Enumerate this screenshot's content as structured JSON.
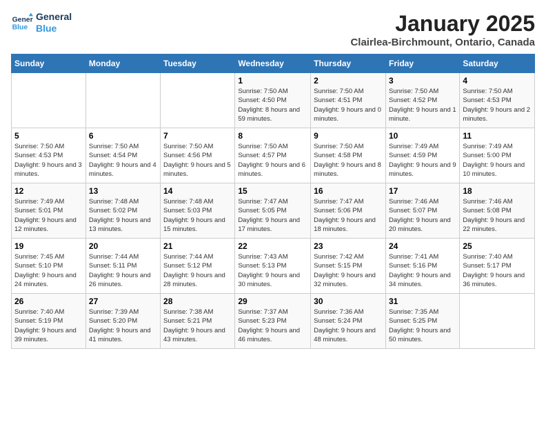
{
  "header": {
    "logo_line1": "General",
    "logo_line2": "Blue",
    "title": "January 2025",
    "subtitle": "Clairlea-Birchmount, Ontario, Canada"
  },
  "weekdays": [
    "Sunday",
    "Monday",
    "Tuesday",
    "Wednesday",
    "Thursday",
    "Friday",
    "Saturday"
  ],
  "weeks": [
    [
      {
        "day": "",
        "sunrise": "",
        "sunset": "",
        "daylight": ""
      },
      {
        "day": "",
        "sunrise": "",
        "sunset": "",
        "daylight": ""
      },
      {
        "day": "",
        "sunrise": "",
        "sunset": "",
        "daylight": ""
      },
      {
        "day": "1",
        "sunrise": "Sunrise: 7:50 AM",
        "sunset": "Sunset: 4:50 PM",
        "daylight": "Daylight: 8 hours and 59 minutes."
      },
      {
        "day": "2",
        "sunrise": "Sunrise: 7:50 AM",
        "sunset": "Sunset: 4:51 PM",
        "daylight": "Daylight: 9 hours and 0 minutes."
      },
      {
        "day": "3",
        "sunrise": "Sunrise: 7:50 AM",
        "sunset": "Sunset: 4:52 PM",
        "daylight": "Daylight: 9 hours and 1 minute."
      },
      {
        "day": "4",
        "sunrise": "Sunrise: 7:50 AM",
        "sunset": "Sunset: 4:53 PM",
        "daylight": "Daylight: 9 hours and 2 minutes."
      }
    ],
    [
      {
        "day": "5",
        "sunrise": "Sunrise: 7:50 AM",
        "sunset": "Sunset: 4:53 PM",
        "daylight": "Daylight: 9 hours and 3 minutes."
      },
      {
        "day": "6",
        "sunrise": "Sunrise: 7:50 AM",
        "sunset": "Sunset: 4:54 PM",
        "daylight": "Daylight: 9 hours and 4 minutes."
      },
      {
        "day": "7",
        "sunrise": "Sunrise: 7:50 AM",
        "sunset": "Sunset: 4:56 PM",
        "daylight": "Daylight: 9 hours and 5 minutes."
      },
      {
        "day": "8",
        "sunrise": "Sunrise: 7:50 AM",
        "sunset": "Sunset: 4:57 PM",
        "daylight": "Daylight: 9 hours and 6 minutes."
      },
      {
        "day": "9",
        "sunrise": "Sunrise: 7:50 AM",
        "sunset": "Sunset: 4:58 PM",
        "daylight": "Daylight: 9 hours and 8 minutes."
      },
      {
        "day": "10",
        "sunrise": "Sunrise: 7:49 AM",
        "sunset": "Sunset: 4:59 PM",
        "daylight": "Daylight: 9 hours and 9 minutes."
      },
      {
        "day": "11",
        "sunrise": "Sunrise: 7:49 AM",
        "sunset": "Sunset: 5:00 PM",
        "daylight": "Daylight: 9 hours and 10 minutes."
      }
    ],
    [
      {
        "day": "12",
        "sunrise": "Sunrise: 7:49 AM",
        "sunset": "Sunset: 5:01 PM",
        "daylight": "Daylight: 9 hours and 12 minutes."
      },
      {
        "day": "13",
        "sunrise": "Sunrise: 7:48 AM",
        "sunset": "Sunset: 5:02 PM",
        "daylight": "Daylight: 9 hours and 13 minutes."
      },
      {
        "day": "14",
        "sunrise": "Sunrise: 7:48 AM",
        "sunset": "Sunset: 5:03 PM",
        "daylight": "Daylight: 9 hours and 15 minutes."
      },
      {
        "day": "15",
        "sunrise": "Sunrise: 7:47 AM",
        "sunset": "Sunset: 5:05 PM",
        "daylight": "Daylight: 9 hours and 17 minutes."
      },
      {
        "day": "16",
        "sunrise": "Sunrise: 7:47 AM",
        "sunset": "Sunset: 5:06 PM",
        "daylight": "Daylight: 9 hours and 18 minutes."
      },
      {
        "day": "17",
        "sunrise": "Sunrise: 7:46 AM",
        "sunset": "Sunset: 5:07 PM",
        "daylight": "Daylight: 9 hours and 20 minutes."
      },
      {
        "day": "18",
        "sunrise": "Sunrise: 7:46 AM",
        "sunset": "Sunset: 5:08 PM",
        "daylight": "Daylight: 9 hours and 22 minutes."
      }
    ],
    [
      {
        "day": "19",
        "sunrise": "Sunrise: 7:45 AM",
        "sunset": "Sunset: 5:10 PM",
        "daylight": "Daylight: 9 hours and 24 minutes."
      },
      {
        "day": "20",
        "sunrise": "Sunrise: 7:44 AM",
        "sunset": "Sunset: 5:11 PM",
        "daylight": "Daylight: 9 hours and 26 minutes."
      },
      {
        "day": "21",
        "sunrise": "Sunrise: 7:44 AM",
        "sunset": "Sunset: 5:12 PM",
        "daylight": "Daylight: 9 hours and 28 minutes."
      },
      {
        "day": "22",
        "sunrise": "Sunrise: 7:43 AM",
        "sunset": "Sunset: 5:13 PM",
        "daylight": "Daylight: 9 hours and 30 minutes."
      },
      {
        "day": "23",
        "sunrise": "Sunrise: 7:42 AM",
        "sunset": "Sunset: 5:15 PM",
        "daylight": "Daylight: 9 hours and 32 minutes."
      },
      {
        "day": "24",
        "sunrise": "Sunrise: 7:41 AM",
        "sunset": "Sunset: 5:16 PM",
        "daylight": "Daylight: 9 hours and 34 minutes."
      },
      {
        "day": "25",
        "sunrise": "Sunrise: 7:40 AM",
        "sunset": "Sunset: 5:17 PM",
        "daylight": "Daylight: 9 hours and 36 minutes."
      }
    ],
    [
      {
        "day": "26",
        "sunrise": "Sunrise: 7:40 AM",
        "sunset": "Sunset: 5:19 PM",
        "daylight": "Daylight: 9 hours and 39 minutes."
      },
      {
        "day": "27",
        "sunrise": "Sunrise: 7:39 AM",
        "sunset": "Sunset: 5:20 PM",
        "daylight": "Daylight: 9 hours and 41 minutes."
      },
      {
        "day": "28",
        "sunrise": "Sunrise: 7:38 AM",
        "sunset": "Sunset: 5:21 PM",
        "daylight": "Daylight: 9 hours and 43 minutes."
      },
      {
        "day": "29",
        "sunrise": "Sunrise: 7:37 AM",
        "sunset": "Sunset: 5:23 PM",
        "daylight": "Daylight: 9 hours and 46 minutes."
      },
      {
        "day": "30",
        "sunrise": "Sunrise: 7:36 AM",
        "sunset": "Sunset: 5:24 PM",
        "daylight": "Daylight: 9 hours and 48 minutes."
      },
      {
        "day": "31",
        "sunrise": "Sunrise: 7:35 AM",
        "sunset": "Sunset: 5:25 PM",
        "daylight": "Daylight: 9 hours and 50 minutes."
      },
      {
        "day": "",
        "sunrise": "",
        "sunset": "",
        "daylight": ""
      }
    ]
  ]
}
